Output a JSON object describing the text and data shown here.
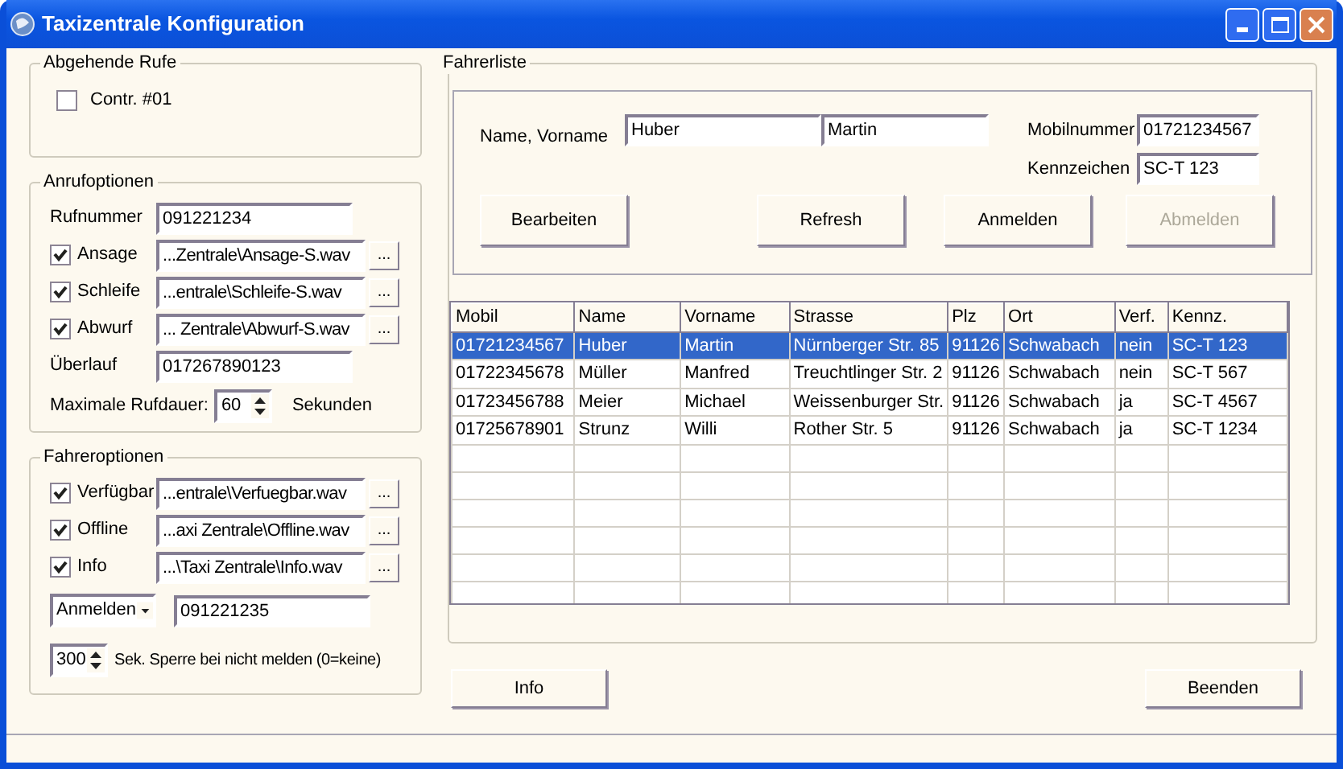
{
  "window": {
    "title": "Taxizentrale Konfiguration"
  },
  "outgoing_calls": {
    "title": "Abgehende Rufe",
    "lines": [
      {
        "label": "Contr. #01",
        "checked": false
      }
    ]
  },
  "call_options": {
    "title": "Anrufoptionen",
    "phone": {
      "label": "Rufnummer",
      "value": "091221234"
    },
    "sounds": [
      {
        "label": "Ansage",
        "checked": true,
        "file": "...Zentrale\\Ansage-S.wav",
        "browse": "..."
      },
      {
        "label": "Schleife",
        "checked": true,
        "file": "...entrale\\Schleife-S.wav",
        "browse": "..."
      },
      {
        "label": "Abwurf",
        "checked": true,
        "file": "... Zentrale\\Abwurf-S.wav",
        "browse": "..."
      }
    ],
    "overflow": {
      "label": "Überlauf",
      "value": "017267890123"
    },
    "max_duration": {
      "label": "Maximale Rufdauer:",
      "value": "60",
      "unit": "Sekunden"
    }
  },
  "driver_options": {
    "title": "Fahreroptionen",
    "sounds": [
      {
        "label": "Verfügbar",
        "checked": true,
        "file": "...entrale\\Verfuegbar.wav",
        "browse": "..."
      },
      {
        "label": "Offline",
        "checked": true,
        "file": "...axi Zentrale\\Offline.wav",
        "browse": "..."
      },
      {
        "label": "Info",
        "checked": true,
        "file": "...\\Taxi Zentrale\\Info.wav",
        "browse": "..."
      }
    ],
    "action": {
      "value": "Anmelden"
    },
    "phone": {
      "value": "091221235"
    },
    "lock": {
      "value": "300",
      "label": "Sek. Sperre bei nicht melden (0=keine)"
    }
  },
  "driver_list": {
    "title": "Fahrerliste",
    "name_label": "Name, Vorname",
    "surname": "Huber",
    "first_name": "Martin",
    "mobile_label": "Mobilnummer",
    "mobile": "01721234567",
    "plate_label": "Kennzeichen",
    "plate": "SC-T 123",
    "buttons": [
      {
        "label": "Bearbeiten",
        "disabled": false
      },
      {
        "label": "Refresh",
        "disabled": false
      },
      {
        "label": "Anmelden",
        "disabled": false
      },
      {
        "label": "Abmelden",
        "disabled": true
      }
    ],
    "table": {
      "columns": [
        "Mobil",
        "Name",
        "Vorname",
        "Strasse",
        "Plz",
        "Ort",
        "Verf.",
        "Kennz."
      ],
      "rows": [
        {
          "selected": true,
          "cells": [
            "01721234567",
            "Huber",
            "Martin",
            "Nürnberger Str. 85",
            "91126",
            "Schwabach",
            "nein",
            "SC-T 123"
          ]
        },
        {
          "selected": false,
          "cells": [
            "01722345678",
            "Müller",
            "Manfred",
            "Treuchtlinger Str. 2",
            "91126",
            "Schwabach",
            "nein",
            "SC-T 567"
          ]
        },
        {
          "selected": false,
          "cells": [
            "01723456788",
            "Meier",
            "Michael",
            "Weissenburger Str.",
            "91126",
            "Schwabach",
            "ja",
            "SC-T 4567"
          ]
        },
        {
          "selected": false,
          "cells": [
            "01725678901",
            "Strunz",
            "Willi",
            "Rother Str. 5",
            "91126",
            "Schwabach",
            "ja",
            "SC-T 1234"
          ]
        }
      ]
    }
  },
  "footer_buttons": [
    {
      "label": "Info"
    },
    {
      "label": "Beenden"
    }
  ]
}
